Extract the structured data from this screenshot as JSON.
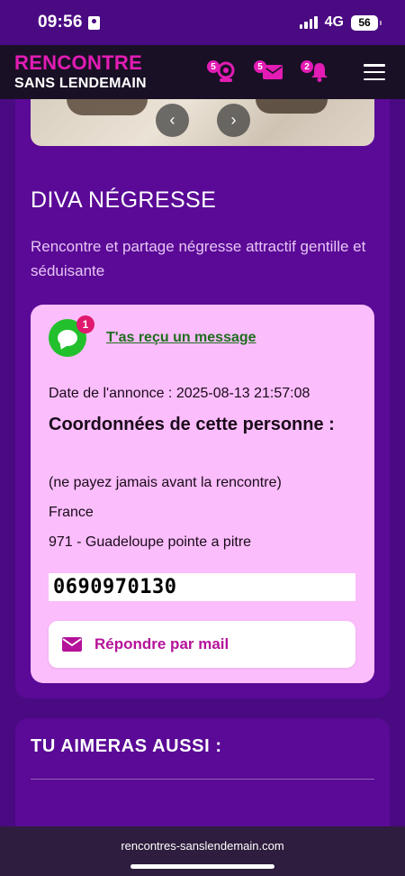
{
  "status": {
    "time": "09:56",
    "network": "4G",
    "battery": "56"
  },
  "nav": {
    "logo_top": "RENCONTRE",
    "logo_bottom": "SANS LENDEMAIN",
    "webcam_badge": "5",
    "mail_badge": "5",
    "bell_badge": "2"
  },
  "carousel": {
    "prev": "‹",
    "next": "›"
  },
  "ad": {
    "title": "DIVA NÉGRESSE",
    "description": "Rencontre et partage négresse attractif gentille et séduisante"
  },
  "info": {
    "message_badge": "1",
    "message_link": "T'as reçu un message",
    "date": "Date de l'annonce : 2025-08-13 21:57:08",
    "contact_title": "Coordonnées de cette personne :",
    "warning": "(ne payez jamais avant la rencontre)",
    "country": "France",
    "region": "971 - Guadeloupe pointe a pitre",
    "phone": "0690970130",
    "reply_label": "Répondre par mail"
  },
  "related": {
    "title": "TU AIMERAS AUSSI :"
  },
  "browser": {
    "url": "rencontres-sanslendemain.com"
  },
  "colors": {
    "brand": "#e21cb4",
    "page_bg": "#4a0a82",
    "card_bg": "#5a0a96",
    "info_bg": "#fbbdfb",
    "nav_bg": "#1a1026"
  }
}
